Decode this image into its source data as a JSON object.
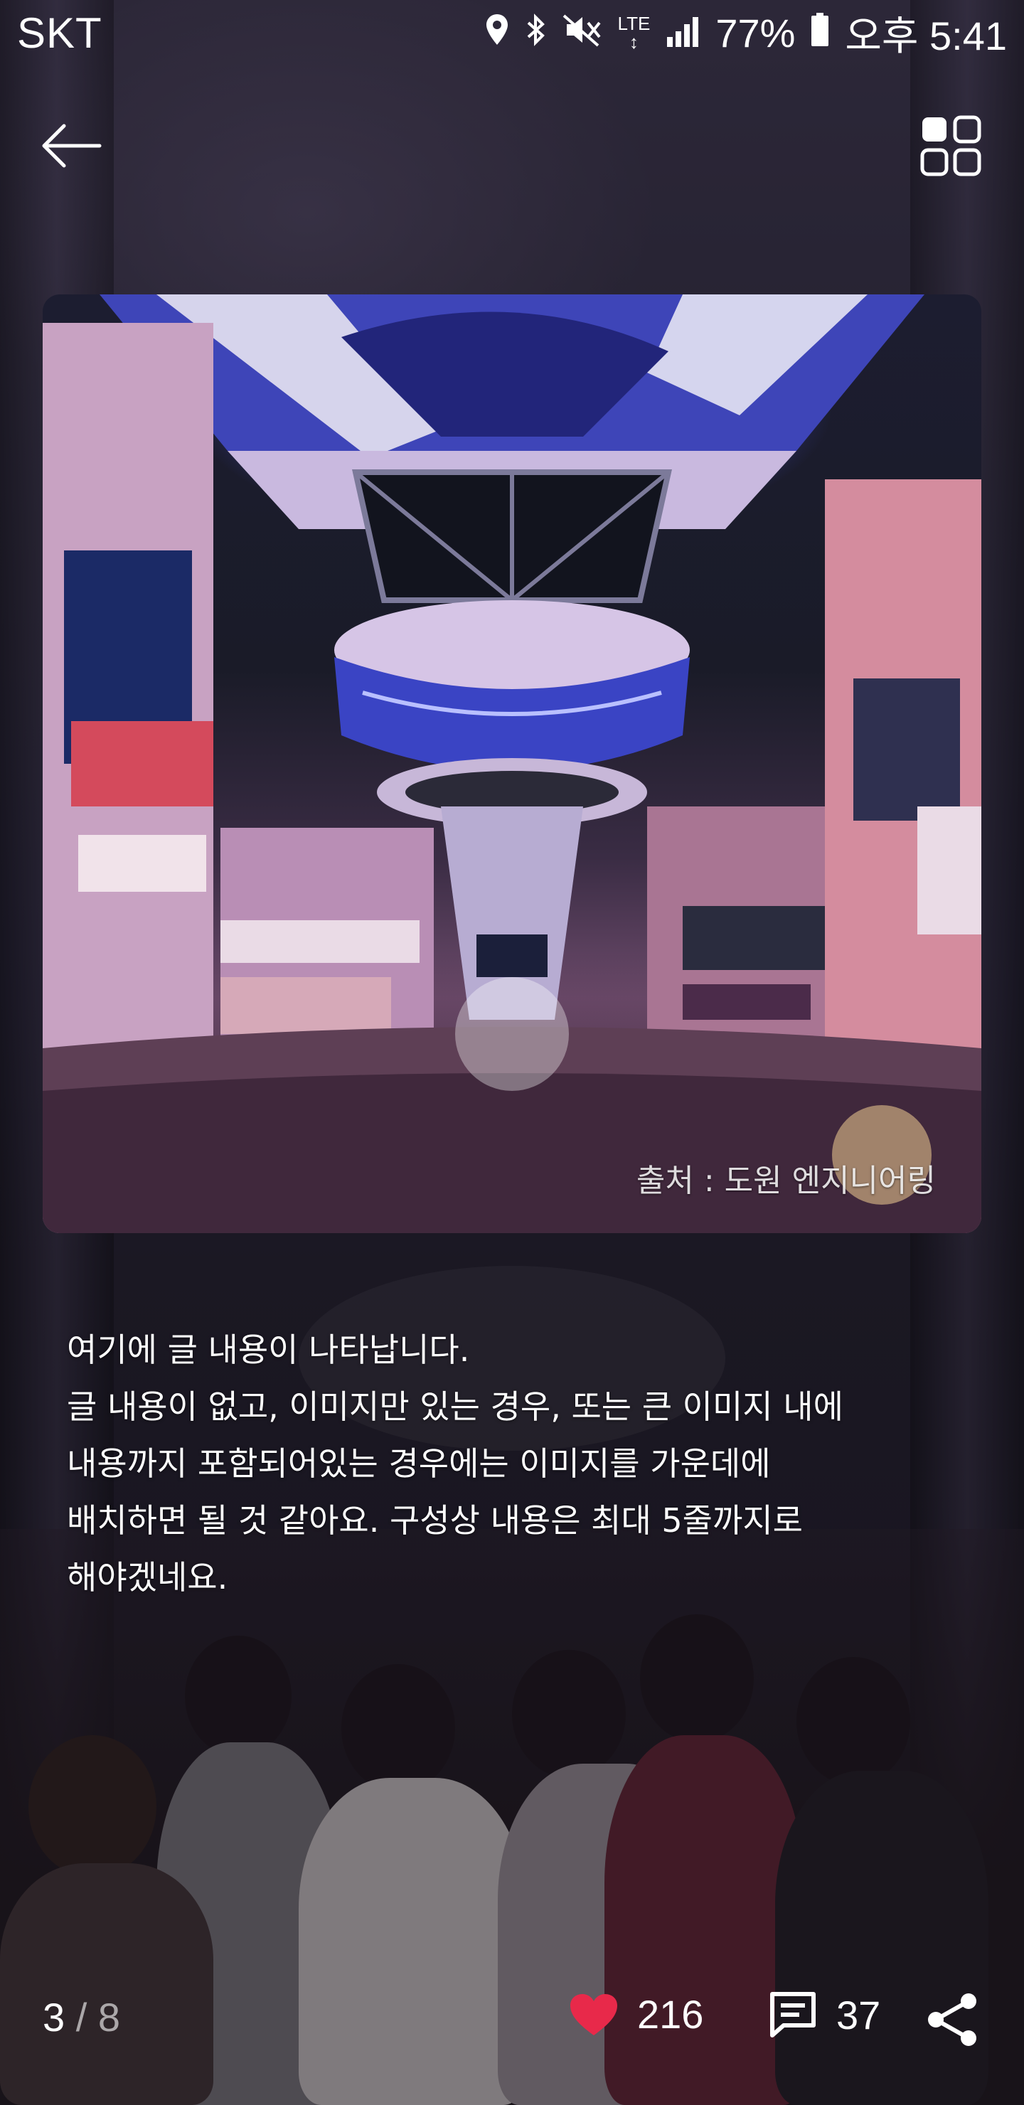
{
  "status_bar": {
    "carrier": "SKT",
    "network": "LTE",
    "battery": "77%",
    "time": "오후 5:41",
    "icons": [
      "location-icon",
      "bluetooth-icon",
      "mute-icon",
      "lte-icon",
      "signal-icon",
      "battery-icon"
    ]
  },
  "appbar": {
    "back_icon": "arrow-left-icon",
    "grid_icon": "grid-view-icon"
  },
  "image": {
    "credit": "출처 : 도원 엔지니어링"
  },
  "content": {
    "lines": [
      "여기에 글 내용이 나타납니다.",
      "글 내용이 없고, 이미지만 있는 경우, 또는 큰 이미지 내에",
      "내용까지 포함되어있는 경우에는 이미지를 가운데에",
      "배치하면 될 것 같아요. 구성상 내용은 최대 5줄까지로",
      "해야겠네요."
    ]
  },
  "footer": {
    "page_current": "3",
    "page_separator": "/",
    "page_total": "8",
    "likes": "216",
    "comments": "37",
    "like_color": "#e8294a"
  }
}
